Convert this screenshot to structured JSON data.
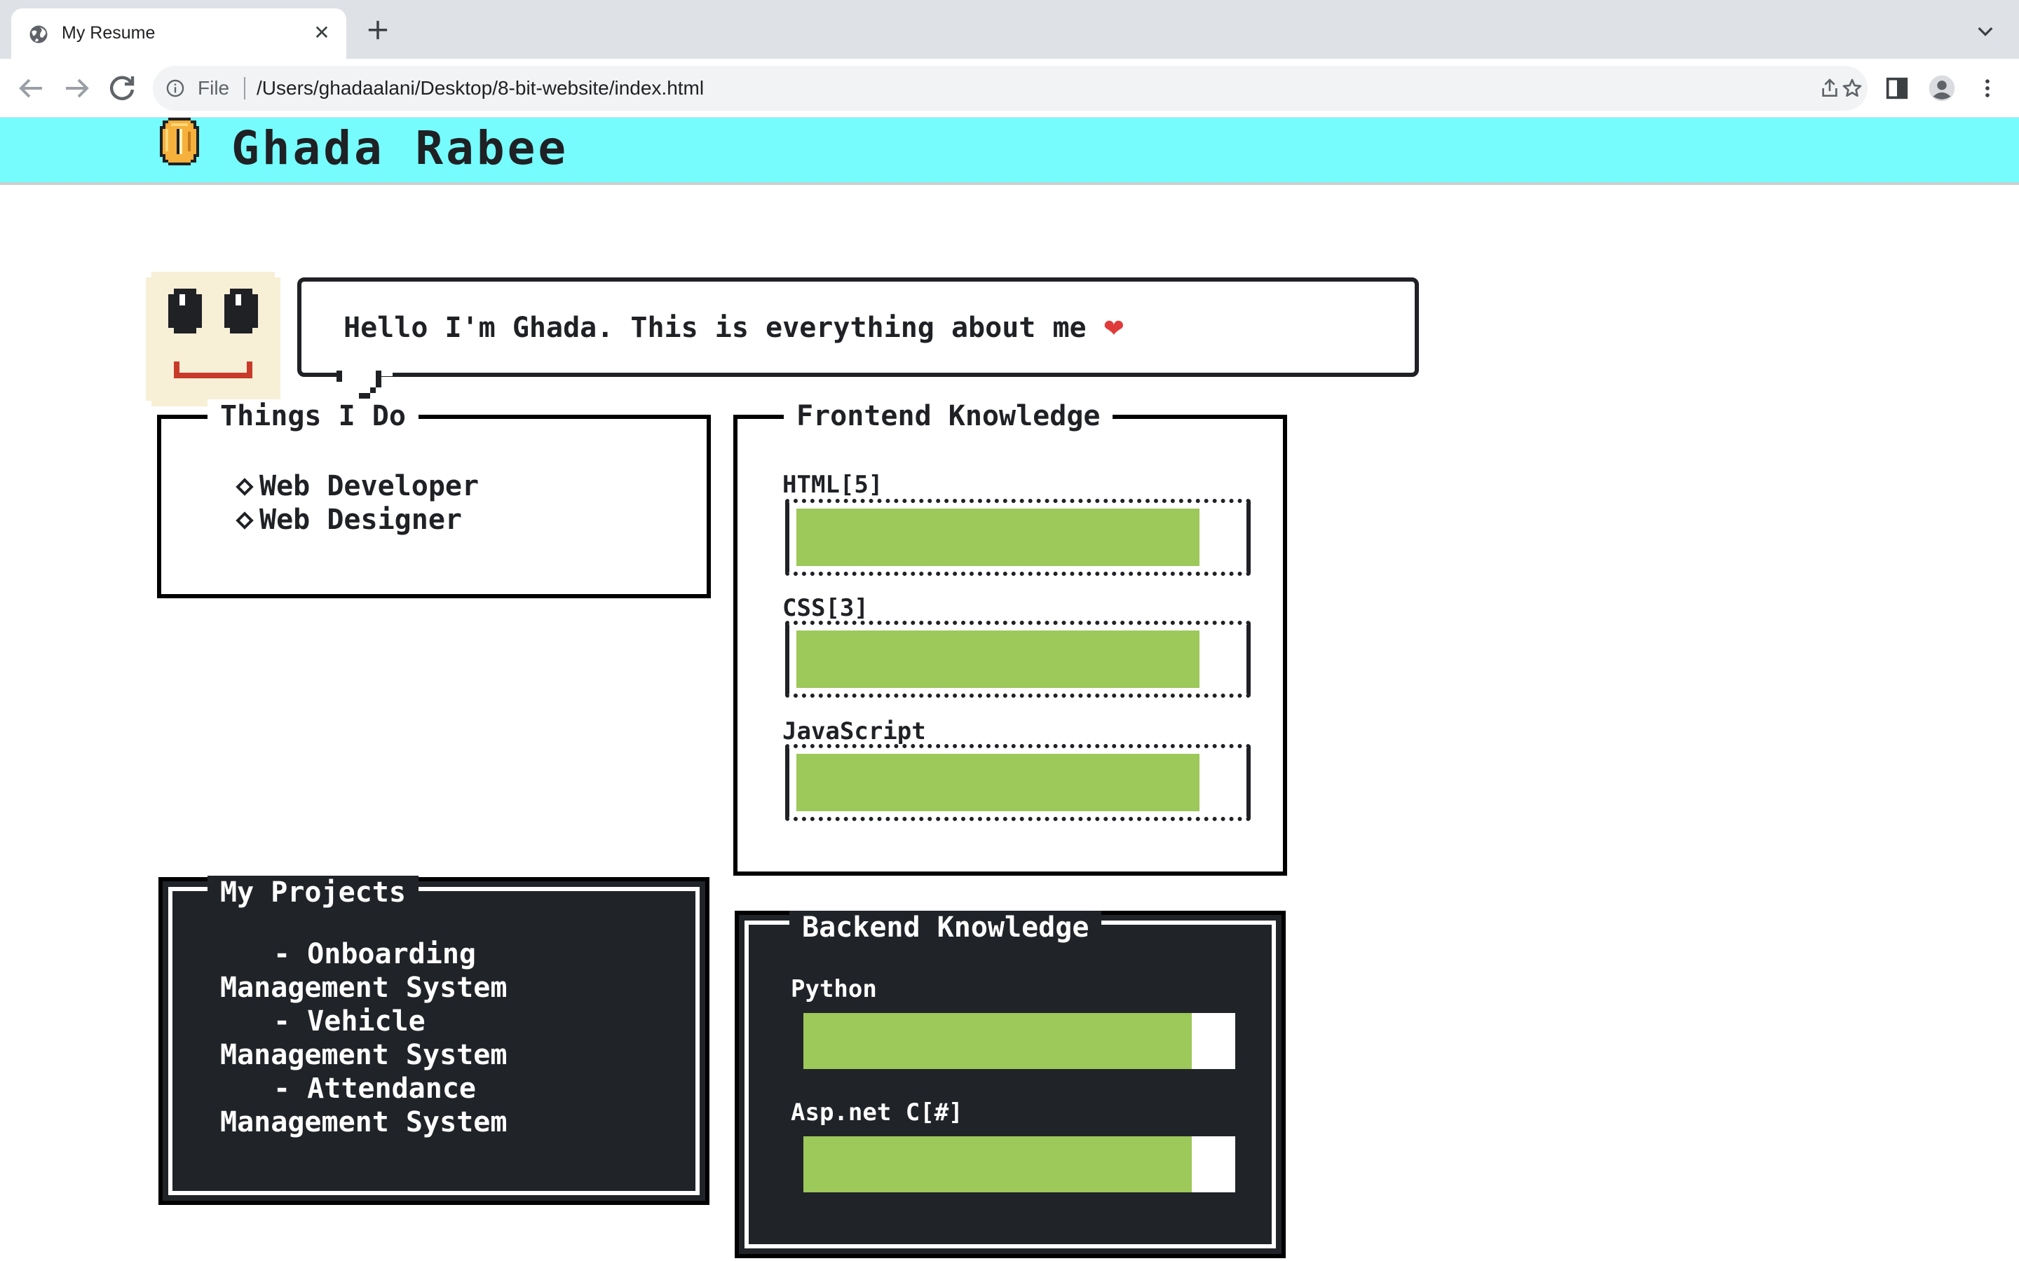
{
  "browser": {
    "tab_title": "My Resume",
    "file_label": "File",
    "url": "/Users/ghadaalani/Desktop/8-bit-website/index.html"
  },
  "header": {
    "title": "Ghada Rabee",
    "logo_icon": "gold-coin-icon"
  },
  "intro": {
    "greeting": "Hello I'm Ghada. This is everything about me",
    "heart": "❤"
  },
  "things_i_do": {
    "title": "Things I Do",
    "items": [
      "Web Developer",
      "Web Designer"
    ]
  },
  "frontend": {
    "title": "Frontend Knowledge",
    "skills": [
      {
        "label": "HTML[5]",
        "level": 0.9
      },
      {
        "label": "CSS[3]",
        "level": 0.9
      },
      {
        "label": "JavaScript",
        "level": 0.9
      }
    ]
  },
  "projects": {
    "title": "My Projects",
    "items": [
      "- Onboarding\nManagement System",
      "- Vehicle\nManagement System",
      "- Attendance\nManagement System"
    ]
  },
  "backend": {
    "title": "Backend Knowledge",
    "skills": [
      {
        "label": "Python",
        "level": 0.9
      },
      {
        "label": "Asp.net C[#]",
        "level": 0.9
      }
    ]
  },
  "colors": {
    "header_bg": "#76fcfc",
    "bar_fill": "#9dc85a",
    "dark_panel": "#202328",
    "ink": "#1f2125"
  }
}
